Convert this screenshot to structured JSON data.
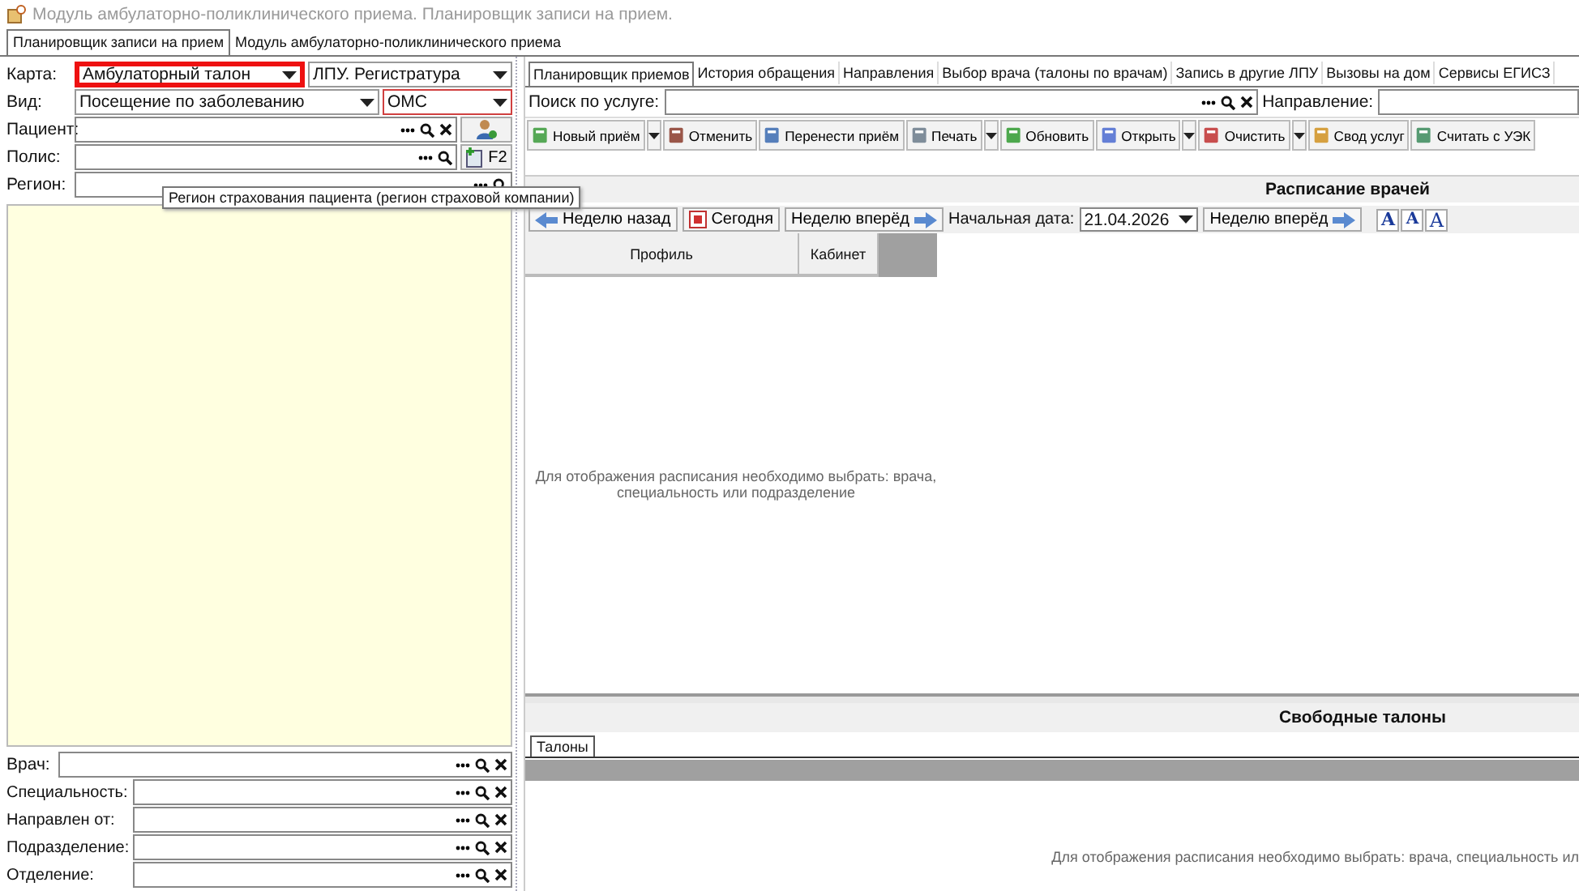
{
  "window": {
    "title": "Модуль амбулаторно-поликлинического приема. Планировщик записи на прием."
  },
  "top_tabs": [
    {
      "label": "Планировщик записи на прием",
      "selected": true
    },
    {
      "label": "Модуль амбулаторно-поликлинического приема",
      "selected": false
    }
  ],
  "left_form": {
    "rows": [
      {
        "label": "Карта:",
        "fields": [
          {
            "kind": "combo",
            "value": "Амбулаторный талон",
            "highlighted": true,
            "required": false
          },
          {
            "kind": "combo",
            "value": "ЛПУ. Регистратура",
            "highlighted": false,
            "required": false
          }
        ]
      },
      {
        "label": "Вид:",
        "fields": [
          {
            "kind": "combo",
            "value": "Посещение по заболеванию",
            "highlighted": false,
            "required": false
          },
          {
            "kind": "combo",
            "value": "ОМС",
            "highlighted": false,
            "required": true
          }
        ]
      },
      {
        "label": "Пациент:",
        "fields": [
          {
            "kind": "lookup",
            "clear": true
          },
          {
            "kind": "patient-button"
          }
        ]
      },
      {
        "label": "Полис:",
        "fields": [
          {
            "kind": "lookup",
            "clear": false
          },
          {
            "kind": "f2-button",
            "label": "F2"
          }
        ]
      },
      {
        "label": "Регион:",
        "fields": [
          {
            "kind": "lookup",
            "clear": false
          }
        ]
      }
    ],
    "tooltip": "Регион страхования пациента (регион страховой компании)",
    "filters": [
      {
        "label": "Врач:"
      },
      {
        "label": "Специальность:"
      },
      {
        "label": "Направлен от:"
      },
      {
        "label": "Подразделение:"
      },
      {
        "label": "Отделение:"
      }
    ]
  },
  "right_tabs": [
    {
      "label": "Планировщик приемов",
      "selected": true
    },
    {
      "label": "История обращения",
      "selected": false
    },
    {
      "label": "Направления",
      "selected": false
    },
    {
      "label": "Выбор врача (талоны по врачам)",
      "selected": false
    },
    {
      "label": "Запись в другие ЛПУ",
      "selected": false
    },
    {
      "label": "Вызовы на дом",
      "selected": false
    },
    {
      "label": "Сервисы ЕГИСЗ",
      "selected": false
    }
  ],
  "search": {
    "label": "Поиск по услуге:",
    "direction_label": "Направление:"
  },
  "toolbar": [
    {
      "label": "Новый приём",
      "dropdown": true
    },
    {
      "label": "Отменить",
      "dropdown": false
    },
    {
      "label": "Перенести приём",
      "dropdown": false
    },
    {
      "label": "Печать",
      "dropdown": true
    },
    {
      "label": "Обновить",
      "dropdown": false
    },
    {
      "label": "Открыть",
      "dropdown": true
    },
    {
      "label": "Очистить",
      "dropdown": true
    },
    {
      "label": "Свод услуг",
      "dropdown": false
    },
    {
      "label": "Считать с УЭК",
      "dropdown": false
    }
  ],
  "schedule": {
    "title": "Расписание врачей",
    "nav": {
      "back": "Неделю назад",
      "today": "Сегодня",
      "forward": "Неделю вперёд",
      "date_label": "Начальная дата:",
      "date": "21.04.2026",
      "forward2": "Неделю вперёд",
      "font_buttons": [
        "A",
        "A",
        "A"
      ]
    },
    "columns": [
      "Профиль",
      "Кабинет"
    ],
    "empty_message": "Для отображения расписания необходимо выбрать: врача, специальность или подразделение"
  },
  "free_tickets": {
    "title": "Свободные талоны",
    "tabs": [
      {
        "label": "Талоны",
        "selected": true
      }
    ],
    "empty_message": "Для отображения расписания необходимо выбрать: врача, специальность ил"
  }
}
